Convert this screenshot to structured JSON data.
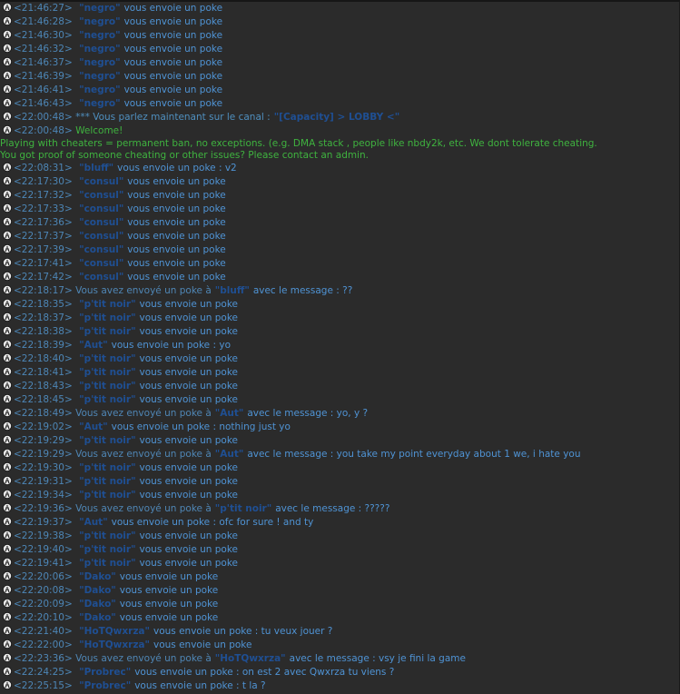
{
  "lines": [
    {
      "type": "poke",
      "ts": "<21:46:27>",
      "nick": "\"negro\"",
      "msg": "vous envoie un poke"
    },
    {
      "type": "poke",
      "ts": "<21:46:28>",
      "nick": "\"negro\"",
      "msg": "vous envoie un poke"
    },
    {
      "type": "poke",
      "ts": "<21:46:30>",
      "nick": "\"negro\"",
      "msg": "vous envoie un poke"
    },
    {
      "type": "poke",
      "ts": "<21:46:32>",
      "nick": "\"negro\"",
      "msg": "vous envoie un poke"
    },
    {
      "type": "poke",
      "ts": "<21:46:37>",
      "nick": "\"negro\"",
      "msg": "vous envoie un poke"
    },
    {
      "type": "poke",
      "ts": "<21:46:39>",
      "nick": "\"negro\"",
      "msg": "vous envoie un poke"
    },
    {
      "type": "poke",
      "ts": "<21:46:41>",
      "nick": "\"negro\"",
      "msg": "vous envoie un poke"
    },
    {
      "type": "poke",
      "ts": "<21:46:43>",
      "nick": "\"negro\"",
      "msg": "vous envoie un poke"
    },
    {
      "type": "channel",
      "ts": "<22:00:48>",
      "pre": "*** Vous parlez maintenant sur le canal :",
      "nick": "\"[Capacity] > LOBBY <\"",
      "msg": ""
    },
    {
      "type": "welcome",
      "ts": "<22:00:48>",
      "msg": "Welcome!"
    },
    {
      "type": "text",
      "msg": "Playing with cheaters = permanent ban, no exceptions. (e.g. DMA stack , people like nbdy2k, etc. We dont tolerate cheating."
    },
    {
      "type": "text",
      "msg": "You got proof of someone cheating or other issues? Please contact an admin."
    },
    {
      "type": "poke",
      "ts": "<22:08:31>",
      "nick": "\"bluff\"",
      "msg": "vous envoie un poke : v2"
    },
    {
      "type": "poke",
      "ts": "<22:17:30>",
      "nick": "\"consul\"",
      "msg": "vous envoie un poke"
    },
    {
      "type": "poke",
      "ts": "<22:17:32>",
      "nick": "\"consul\"",
      "msg": "vous envoie un poke"
    },
    {
      "type": "poke",
      "ts": "<22:17:33>",
      "nick": "\"consul\"",
      "msg": "vous envoie un poke"
    },
    {
      "type": "poke",
      "ts": "<22:17:36>",
      "nick": "\"consul\"",
      "msg": "vous envoie un poke"
    },
    {
      "type": "poke",
      "ts": "<22:17:37>",
      "nick": "\"consul\"",
      "msg": "vous envoie un poke"
    },
    {
      "type": "poke",
      "ts": "<22:17:39>",
      "nick": "\"consul\"",
      "msg": "vous envoie un poke"
    },
    {
      "type": "poke",
      "ts": "<22:17:41>",
      "nick": "\"consul\"",
      "msg": "vous envoie un poke"
    },
    {
      "type": "poke",
      "ts": "<22:17:42>",
      "nick": "\"consul\"",
      "msg": "vous envoie un poke"
    },
    {
      "type": "sent",
      "ts": "<22:18:17>",
      "pre": "Vous avez envoyé un poke à",
      "nick": "\"bluff\"",
      "msg": "avec le message : ??"
    },
    {
      "type": "poke",
      "ts": "<22:18:35>",
      "nick": "\"p'tit noir\"",
      "msg": "vous envoie un poke"
    },
    {
      "type": "poke",
      "ts": "<22:18:37>",
      "nick": "\"p'tit noir\"",
      "msg": "vous envoie un poke"
    },
    {
      "type": "poke",
      "ts": "<22:18:38>",
      "nick": "\"p'tit noir\"",
      "msg": "vous envoie un poke"
    },
    {
      "type": "poke",
      "ts": "<22:18:39>",
      "nick": "\"Aut\"",
      "msg": "vous envoie un poke : yo"
    },
    {
      "type": "poke",
      "ts": "<22:18:40>",
      "nick": "\"p'tit noir\"",
      "msg": "vous envoie un poke"
    },
    {
      "type": "poke",
      "ts": "<22:18:41>",
      "nick": "\"p'tit noir\"",
      "msg": "vous envoie un poke"
    },
    {
      "type": "poke",
      "ts": "<22:18:43>",
      "nick": "\"p'tit noir\"",
      "msg": "vous envoie un poke"
    },
    {
      "type": "poke",
      "ts": "<22:18:45>",
      "nick": "\"p'tit noir\"",
      "msg": "vous envoie un poke"
    },
    {
      "type": "sent",
      "ts": "<22:18:49>",
      "pre": "Vous avez envoyé un poke à",
      "nick": "\"Aut\"",
      "msg": "avec le message : yo, y ?"
    },
    {
      "type": "poke",
      "ts": "<22:19:02>",
      "nick": "\"Aut\"",
      "msg": "vous envoie un poke : nothing just yo"
    },
    {
      "type": "poke",
      "ts": "<22:19:29>",
      "nick": "\"p'tit noir\"",
      "msg": "vous envoie un poke"
    },
    {
      "type": "sent",
      "ts": "<22:19:29>",
      "pre": "Vous avez envoyé un poke à",
      "nick": "\"Aut\"",
      "msg": "avec le message : you take my point everyday about 1 we, i hate you"
    },
    {
      "type": "poke",
      "ts": "<22:19:30>",
      "nick": "\"p'tit noir\"",
      "msg": "vous envoie un poke"
    },
    {
      "type": "poke",
      "ts": "<22:19:31>",
      "nick": "\"p'tit noir\"",
      "msg": "vous envoie un poke"
    },
    {
      "type": "poke",
      "ts": "<22:19:34>",
      "nick": "\"p'tit noir\"",
      "msg": "vous envoie un poke"
    },
    {
      "type": "sent",
      "ts": "<22:19:36>",
      "pre": "Vous avez envoyé un poke à",
      "nick": "\"p'tit noir\"",
      "msg": "avec le message : ?????"
    },
    {
      "type": "poke",
      "ts": "<22:19:37>",
      "nick": "\"Aut\"",
      "msg": "vous envoie un poke : ofc for sure ! and ty"
    },
    {
      "type": "poke",
      "ts": "<22:19:38>",
      "nick": "\"p'tit noir\"",
      "msg": "vous envoie un poke"
    },
    {
      "type": "poke",
      "ts": "<22:19:40>",
      "nick": "\"p'tit noir\"",
      "msg": "vous envoie un poke"
    },
    {
      "type": "poke",
      "ts": "<22:19:41>",
      "nick": "\"p'tit noir\"",
      "msg": "vous envoie un poke"
    },
    {
      "type": "poke",
      "ts": "<22:20:06>",
      "nick": "\"Dako\"",
      "msg": "vous envoie un poke"
    },
    {
      "type": "poke",
      "ts": "<22:20:08>",
      "nick": "\"Dako\"",
      "msg": "vous envoie un poke"
    },
    {
      "type": "poke",
      "ts": "<22:20:09>",
      "nick": "\"Dako\"",
      "msg": "vous envoie un poke"
    },
    {
      "type": "poke",
      "ts": "<22:20:10>",
      "nick": "\"Dako\"",
      "msg": "vous envoie un poke"
    },
    {
      "type": "poke",
      "ts": "<22:21:40>",
      "nick": "\"HoTQwxrza\"",
      "msg": "vous envoie un poke : tu veux jouer ?"
    },
    {
      "type": "poke",
      "ts": "<22:22:00>",
      "nick": "\"HoTQwxrza\"",
      "msg": "vous envoie un poke"
    },
    {
      "type": "sent",
      "ts": "<22:23:36>",
      "pre": "Vous avez envoyé un poke à",
      "nick": "\"HoTQwxrza\"",
      "msg": "avec le message : vsy je fini la game"
    },
    {
      "type": "poke",
      "ts": "<22:24:25>",
      "nick": "\"Probrec\"",
      "msg": "vous envoie un poke : on est 2 avec Qwxrza tu viens ?"
    },
    {
      "type": "poke",
      "ts": "<22:25:15>",
      "nick": "\"Probrec\"",
      "msg": "vous envoie un poke : t la ?"
    }
  ],
  "colors": {
    "background": "#2b2b2b",
    "timestamp": "#4d86b6",
    "nick": "#1f4f93",
    "message": "#4f93d4",
    "welcome": "#3fb33f"
  },
  "icon": "info-icon"
}
